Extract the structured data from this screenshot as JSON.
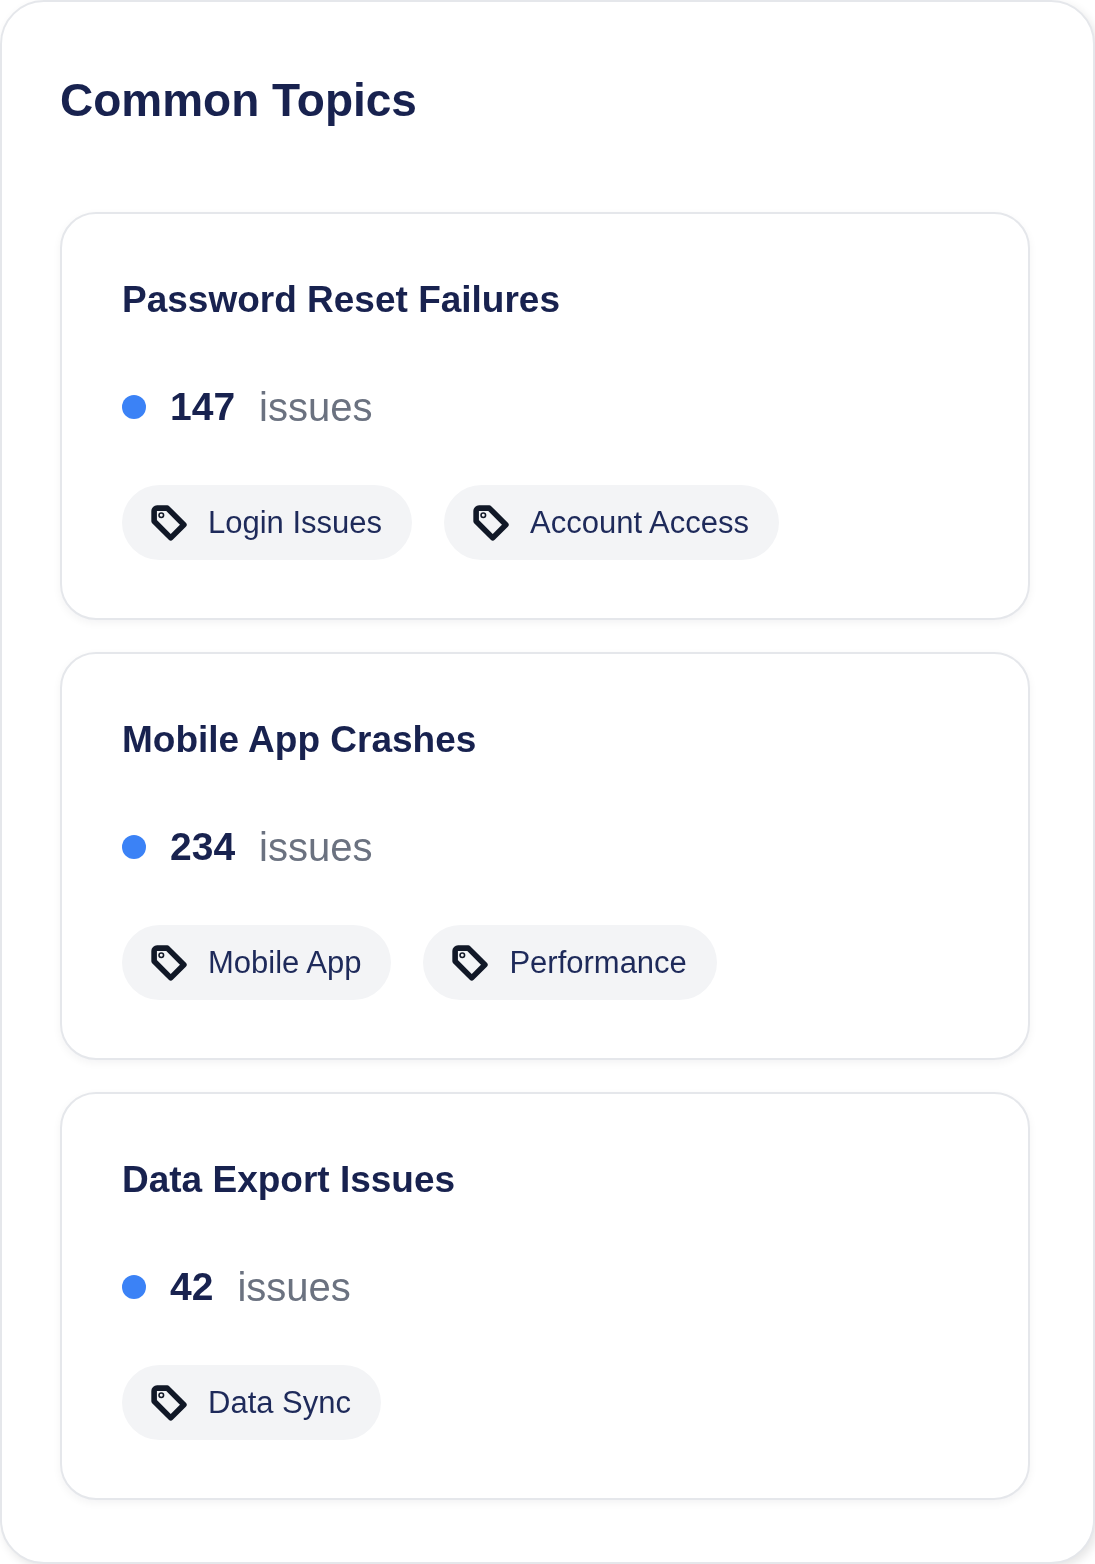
{
  "panel": {
    "title": "Common Topics"
  },
  "topics": [
    {
      "title": "Password Reset Failures",
      "count": "147",
      "unit": "issues",
      "tags": [
        "Login Issues",
        "Account Access"
      ]
    },
    {
      "title": "Mobile App Crashes",
      "count": "234",
      "unit": "issues",
      "tags": [
        "Mobile App",
        "Performance"
      ]
    },
    {
      "title": "Data Export Issues",
      "count": "42",
      "unit": "issues",
      "tags": [
        "Data Sync"
      ]
    }
  ]
}
